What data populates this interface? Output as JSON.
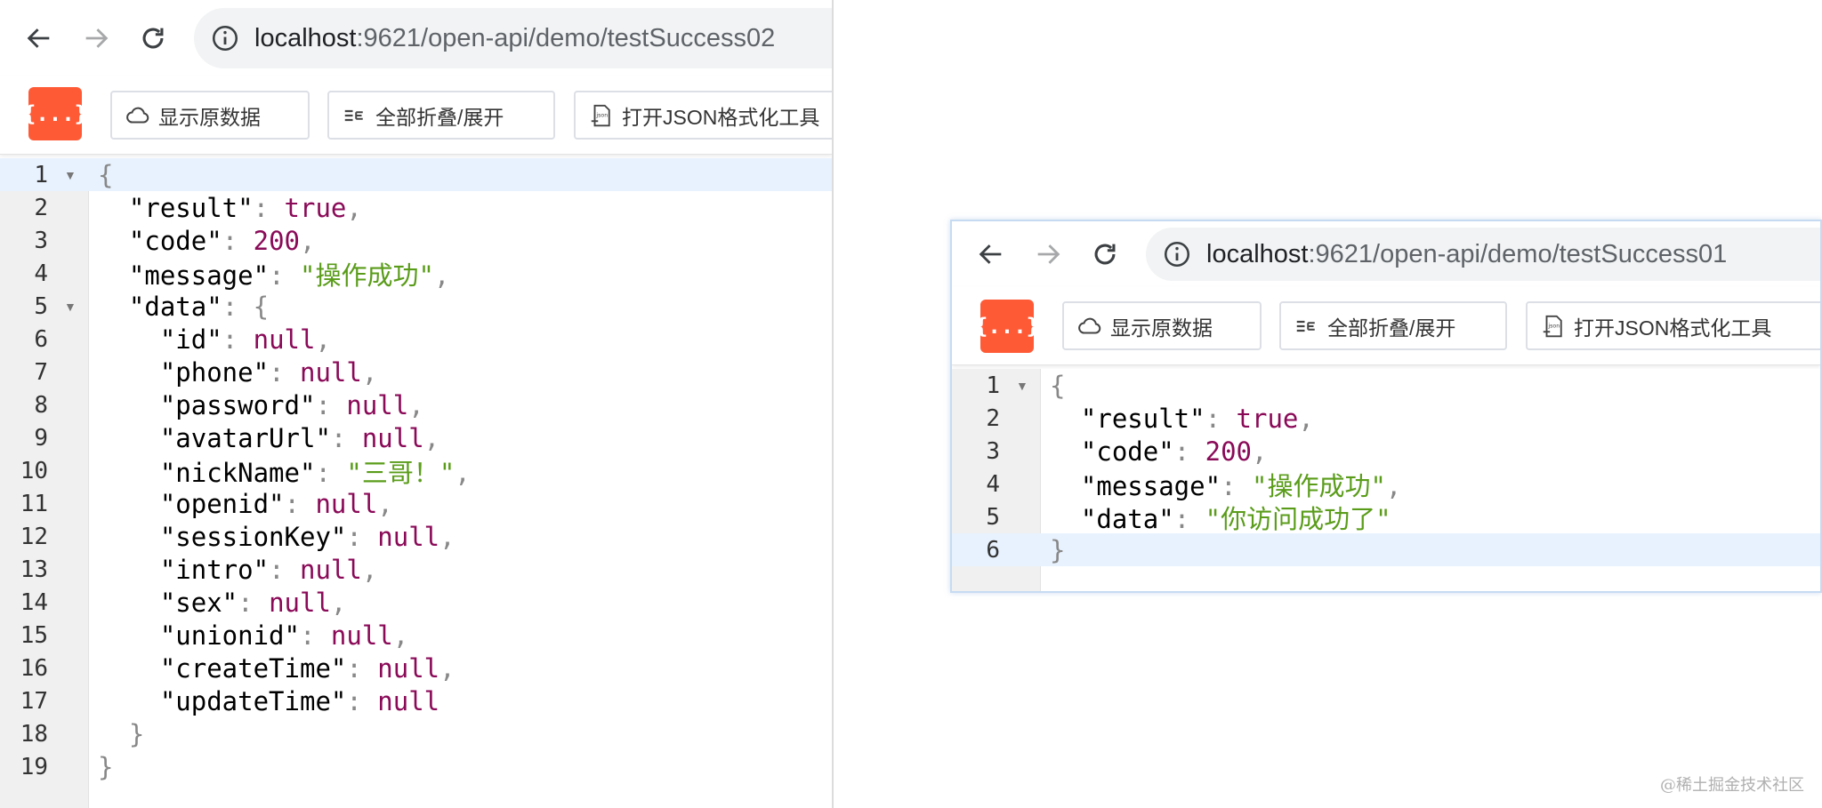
{
  "left_window": {
    "url_host": "localhost",
    "url_path": ":9621/open-api/demo/testSuccess02",
    "toolbar": {
      "logo": "{...}",
      "raw_label": "显示原数据",
      "fold_label": "全部折叠/展开",
      "open_label": "打开JSON格式化工具"
    },
    "lines": [
      {
        "n": "1",
        "fold": true,
        "indent": "",
        "tokens": [
          {
            "t": "p",
            "v": "{"
          }
        ]
      },
      {
        "n": "2",
        "fold": false,
        "indent": "  ",
        "tokens": [
          {
            "t": "k",
            "v": "\"result\""
          },
          {
            "t": "p",
            "v": ": "
          },
          {
            "t": "b",
            "v": "true"
          },
          {
            "t": "p",
            "v": ","
          }
        ]
      },
      {
        "n": "3",
        "fold": false,
        "indent": "  ",
        "tokens": [
          {
            "t": "k",
            "v": "\"code\""
          },
          {
            "t": "p",
            "v": ": "
          },
          {
            "t": "n",
            "v": "200"
          },
          {
            "t": "p",
            "v": ","
          }
        ]
      },
      {
        "n": "4",
        "fold": false,
        "indent": "  ",
        "tokens": [
          {
            "t": "k",
            "v": "\"message\""
          },
          {
            "t": "p",
            "v": ": "
          },
          {
            "t": "s",
            "v": "\"操作成功\""
          },
          {
            "t": "p",
            "v": ","
          }
        ]
      },
      {
        "n": "5",
        "fold": true,
        "indent": "  ",
        "tokens": [
          {
            "t": "k",
            "v": "\"data\""
          },
          {
            "t": "p",
            "v": ": {"
          }
        ]
      },
      {
        "n": "6",
        "fold": false,
        "indent": "    ",
        "tokens": [
          {
            "t": "k",
            "v": "\"id\""
          },
          {
            "t": "p",
            "v": ": "
          },
          {
            "t": "n",
            "v": "null"
          },
          {
            "t": "p",
            "v": ","
          }
        ]
      },
      {
        "n": "7",
        "fold": false,
        "indent": "    ",
        "tokens": [
          {
            "t": "k",
            "v": "\"phone\""
          },
          {
            "t": "p",
            "v": ": "
          },
          {
            "t": "n",
            "v": "null"
          },
          {
            "t": "p",
            "v": ","
          }
        ]
      },
      {
        "n": "8",
        "fold": false,
        "indent": "    ",
        "tokens": [
          {
            "t": "k",
            "v": "\"password\""
          },
          {
            "t": "p",
            "v": ": "
          },
          {
            "t": "n",
            "v": "null"
          },
          {
            "t": "p",
            "v": ","
          }
        ]
      },
      {
        "n": "9",
        "fold": false,
        "indent": "    ",
        "tokens": [
          {
            "t": "k",
            "v": "\"avatarUrl\""
          },
          {
            "t": "p",
            "v": ": "
          },
          {
            "t": "n",
            "v": "null"
          },
          {
            "t": "p",
            "v": ","
          }
        ]
      },
      {
        "n": "10",
        "fold": false,
        "indent": "    ",
        "tokens": [
          {
            "t": "k",
            "v": "\"nickName\""
          },
          {
            "t": "p",
            "v": ": "
          },
          {
            "t": "s",
            "v": "\"三哥！\""
          },
          {
            "t": "p",
            "v": ","
          }
        ]
      },
      {
        "n": "11",
        "fold": false,
        "indent": "    ",
        "tokens": [
          {
            "t": "k",
            "v": "\"openid\""
          },
          {
            "t": "p",
            "v": ": "
          },
          {
            "t": "n",
            "v": "null"
          },
          {
            "t": "p",
            "v": ","
          }
        ]
      },
      {
        "n": "12",
        "fold": false,
        "indent": "    ",
        "tokens": [
          {
            "t": "k",
            "v": "\"sessionKey\""
          },
          {
            "t": "p",
            "v": ": "
          },
          {
            "t": "n",
            "v": "null"
          },
          {
            "t": "p",
            "v": ","
          }
        ]
      },
      {
        "n": "13",
        "fold": false,
        "indent": "    ",
        "tokens": [
          {
            "t": "k",
            "v": "\"intro\""
          },
          {
            "t": "p",
            "v": ": "
          },
          {
            "t": "n",
            "v": "null"
          },
          {
            "t": "p",
            "v": ","
          }
        ]
      },
      {
        "n": "14",
        "fold": false,
        "indent": "    ",
        "tokens": [
          {
            "t": "k",
            "v": "\"sex\""
          },
          {
            "t": "p",
            "v": ": "
          },
          {
            "t": "n",
            "v": "null"
          },
          {
            "t": "p",
            "v": ","
          }
        ]
      },
      {
        "n": "15",
        "fold": false,
        "indent": "    ",
        "tokens": [
          {
            "t": "k",
            "v": "\"unionid\""
          },
          {
            "t": "p",
            "v": ": "
          },
          {
            "t": "n",
            "v": "null"
          },
          {
            "t": "p",
            "v": ","
          }
        ]
      },
      {
        "n": "16",
        "fold": false,
        "indent": "    ",
        "tokens": [
          {
            "t": "k",
            "v": "\"createTime\""
          },
          {
            "t": "p",
            "v": ": "
          },
          {
            "t": "n",
            "v": "null"
          },
          {
            "t": "p",
            "v": ","
          }
        ]
      },
      {
        "n": "17",
        "fold": false,
        "indent": "    ",
        "tokens": [
          {
            "t": "k",
            "v": "\"updateTime\""
          },
          {
            "t": "p",
            "v": ": "
          },
          {
            "t": "n",
            "v": "null"
          }
        ]
      },
      {
        "n": "18",
        "fold": false,
        "indent": "  ",
        "tokens": [
          {
            "t": "p",
            "v": "}"
          }
        ]
      },
      {
        "n": "19",
        "fold": false,
        "indent": "",
        "tokens": [
          {
            "t": "p",
            "v": "}"
          }
        ]
      }
    ],
    "active_line": 1
  },
  "right_window": {
    "url_host": "localhost",
    "url_path": ":9621/open-api/demo/testSuccess01",
    "toolbar": {
      "logo": "{...}",
      "raw_label": "显示原数据",
      "fold_label": "全部折叠/展开",
      "open_label": "打开JSON格式化工具"
    },
    "lines": [
      {
        "n": "1",
        "fold": true,
        "indent": "",
        "tokens": [
          {
            "t": "p",
            "v": "{"
          }
        ]
      },
      {
        "n": "2",
        "fold": false,
        "indent": "  ",
        "tokens": [
          {
            "t": "k",
            "v": "\"result\""
          },
          {
            "t": "p",
            "v": ": "
          },
          {
            "t": "b",
            "v": "true"
          },
          {
            "t": "p",
            "v": ","
          }
        ]
      },
      {
        "n": "3",
        "fold": false,
        "indent": "  ",
        "tokens": [
          {
            "t": "k",
            "v": "\"code\""
          },
          {
            "t": "p",
            "v": ": "
          },
          {
            "t": "n",
            "v": "200"
          },
          {
            "t": "p",
            "v": ","
          }
        ]
      },
      {
        "n": "4",
        "fold": false,
        "indent": "  ",
        "tokens": [
          {
            "t": "k",
            "v": "\"message\""
          },
          {
            "t": "p",
            "v": ": "
          },
          {
            "t": "s",
            "v": "\"操作成功\""
          },
          {
            "t": "p",
            "v": ","
          }
        ]
      },
      {
        "n": "5",
        "fold": false,
        "indent": "  ",
        "tokens": [
          {
            "t": "k",
            "v": "\"data\""
          },
          {
            "t": "p",
            "v": ": "
          },
          {
            "t": "s",
            "v": "\"你访问成功了\""
          }
        ]
      },
      {
        "n": "6",
        "fold": false,
        "indent": "",
        "tokens": [
          {
            "t": "p",
            "v": "}"
          }
        ]
      }
    ],
    "active_line": 6
  },
  "icons": {
    "back": "arrow-left-icon",
    "forward": "arrow-right-icon",
    "reload": "reload-icon",
    "site_info": "info-circle-icon",
    "raw": "cloud-icon",
    "fold": "fold-lines-icon",
    "open": "json-file-icon"
  },
  "colors": {
    "logo_bg": "#ff5a36",
    "string": "#5a9c1a",
    "literal": "#8a0a58",
    "active_line": "#e8f2fe"
  },
  "watermark": "@稀土掘金技术社区"
}
